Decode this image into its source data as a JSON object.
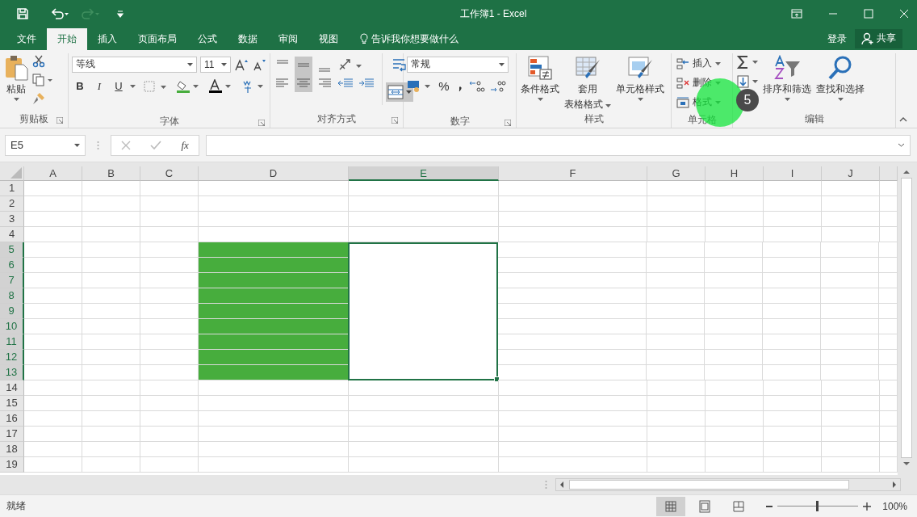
{
  "window": {
    "title": "工作簿1 - Excel"
  },
  "menu_tabs": [
    {
      "label": "文件",
      "selected": false
    },
    {
      "label": "开始",
      "selected": true
    },
    {
      "label": "插入",
      "selected": false
    },
    {
      "label": "页面布局",
      "selected": false
    },
    {
      "label": "公式",
      "selected": false
    },
    {
      "label": "数据",
      "selected": false
    },
    {
      "label": "审阅",
      "selected": false
    },
    {
      "label": "视图",
      "selected": false
    }
  ],
  "tell_me": {
    "placeholder": "告诉我你想要做什么"
  },
  "sign_in": "登录",
  "share": "共享",
  "ribbon": {
    "clipboard": {
      "title": "剪贴板",
      "paste": "粘贴"
    },
    "font": {
      "title": "字体",
      "family": "等线",
      "size": "11",
      "bold": "B",
      "italic": "I",
      "underline": "U"
    },
    "alignment": {
      "title": "对齐方式"
    },
    "number": {
      "title": "数字",
      "format": "常规",
      "percent": "%"
    },
    "styles": {
      "title": "样式",
      "conditional": "条件格式",
      "table_line1": "套用",
      "table_line2": "表格格式",
      "cell_styles": "单元格样式"
    },
    "cells": {
      "title": "单元格",
      "items": [
        {
          "kind": "insert",
          "label": "插入"
        },
        {
          "kind": "delete",
          "label": "删除"
        },
        {
          "kind": "format",
          "label": "格式"
        }
      ]
    },
    "editing": {
      "title": "编辑",
      "sort": "排序和筛选",
      "find": "查找和选择"
    }
  },
  "click_marker": {
    "badge": "5"
  },
  "formula_bar": {
    "name_box": "E5",
    "fx": "fx"
  },
  "columns": [
    {
      "label": "A",
      "selected": false
    },
    {
      "label": "B",
      "selected": false
    },
    {
      "label": "C",
      "selected": false
    },
    {
      "label": "D",
      "selected": false,
      "color": "#47ad3d"
    },
    {
      "label": "E",
      "selected": true
    },
    {
      "label": "F",
      "selected": false
    },
    {
      "label": "G",
      "selected": false
    },
    {
      "label": "H",
      "selected": false
    },
    {
      "label": "I",
      "selected": false
    },
    {
      "label": "J",
      "selected": false
    }
  ],
  "rows": [
    {
      "label": "1",
      "selected": false
    },
    {
      "label": "2",
      "selected": false
    },
    {
      "label": "3",
      "selected": false
    },
    {
      "label": "4",
      "selected": false
    },
    {
      "label": "5",
      "selected": true
    },
    {
      "label": "6",
      "selected": true
    },
    {
      "label": "7",
      "selected": true
    },
    {
      "label": "8",
      "selected": true
    },
    {
      "label": "9",
      "selected": true
    },
    {
      "label": "10",
      "selected": true
    },
    {
      "label": "11",
      "selected": true
    },
    {
      "label": "12",
      "selected": true
    },
    {
      "label": "13",
      "selected": true
    },
    {
      "label": "14",
      "selected": false
    },
    {
      "label": "15",
      "selected": false
    },
    {
      "label": "16",
      "selected": false
    },
    {
      "label": "17",
      "selected": false
    },
    {
      "label": "18",
      "selected": false
    },
    {
      "label": "19",
      "selected": false
    }
  ],
  "status_bar": {
    "status": "就绪",
    "zoom": "100%",
    "zoom_slider": {
      "level": 0.48
    }
  }
}
